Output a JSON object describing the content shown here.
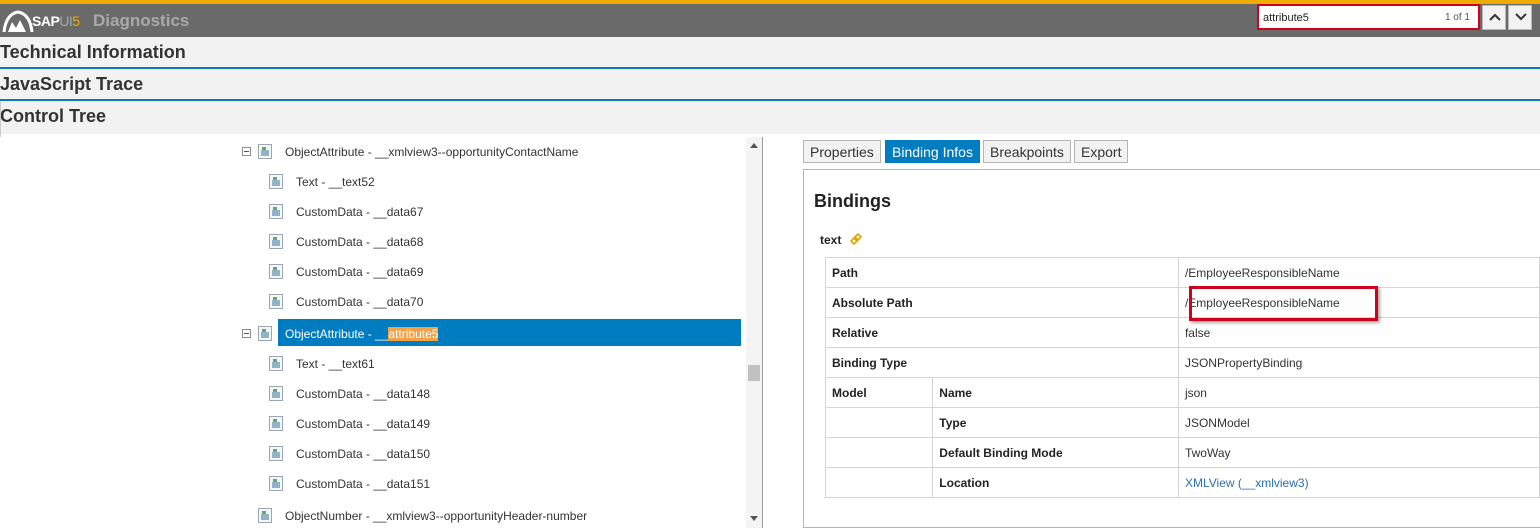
{
  "header": {
    "logo_main": "SAP",
    "logo_ui": "UI",
    "logo_five": "5",
    "title": "Diagnostics",
    "accent_color": "#f0ab00",
    "bar_color": "#6a6a6a"
  },
  "search": {
    "value": "attribute5",
    "count": "1 of 1",
    "prev_icon": "chevron-up-icon",
    "next_icon": "chevron-down-icon"
  },
  "sections": {
    "technical": "Technical Information",
    "javascript": "JavaScript Trace",
    "control_tree": "Control Tree"
  },
  "tree": {
    "nodes": [
      {
        "label": "ObjectAttribute - __xmlview3--opportunityContactName",
        "expanded": true
      },
      {
        "label": "Text - __text52"
      },
      {
        "label": "CustomData - __data67"
      },
      {
        "label": "CustomData - __data68"
      },
      {
        "label": "CustomData - __data69"
      },
      {
        "label": "CustomData - __data70"
      },
      {
        "label_prefix": "ObjectAttribute - __",
        "label_match": "attribute5",
        "expanded": true,
        "selected": true
      },
      {
        "label": "Text - __text61"
      },
      {
        "label": "CustomData - __data148"
      },
      {
        "label": "CustomData - __data149"
      },
      {
        "label": "CustomData - __data150"
      },
      {
        "label": "CustomData - __data151"
      },
      {
        "label": "ObjectNumber - __xmlview3--opportunityHeader-number"
      }
    ],
    "selected_color": "#007cc0",
    "match_color": "#f4a145"
  },
  "tabs": {
    "properties": "Properties",
    "binding_infos": "Binding Infos",
    "breakpoints": "Breakpoints",
    "export": "Export",
    "active": "Binding Infos"
  },
  "bindings": {
    "title": "Bindings",
    "name": "text",
    "icon": "binding-link-icon",
    "rows": {
      "path_key": "Path",
      "path_value": "/EmployeeResponsibleName",
      "abs_path_key": "Absolute Path",
      "abs_path_value": "/EmployeeResponsibleName",
      "relative_key": "Relative",
      "relative_value": "false",
      "binding_type_key": "Binding Type",
      "binding_type_value": "JSONPropertyBinding",
      "model_key": "Model",
      "name_key": "Name",
      "name_value": "json",
      "type_key": "Type",
      "type_value": "JSONModel",
      "mode_key": "Default Binding Mode",
      "mode_value": "TwoWay",
      "location_key": "Location",
      "location_value": "XMLView (__xmlview3)"
    }
  }
}
